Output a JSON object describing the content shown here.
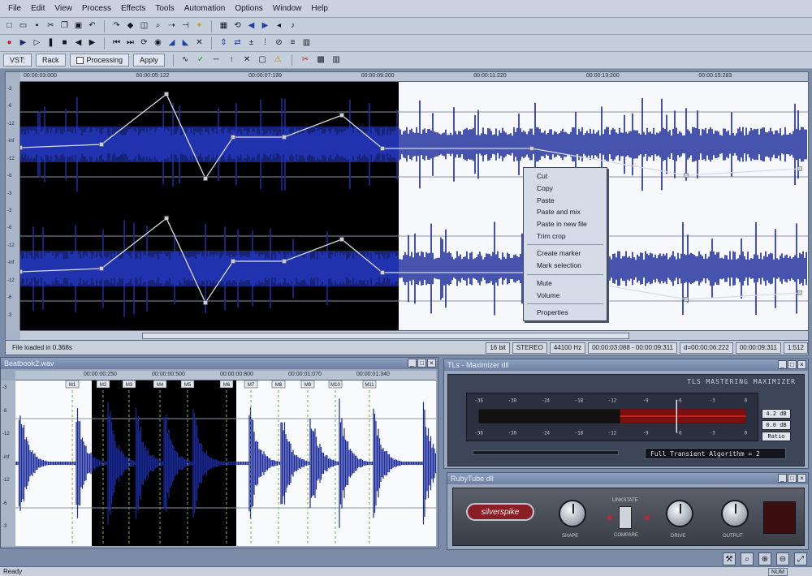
{
  "menu": [
    "File",
    "Edit",
    "View",
    "Process",
    "Effects",
    "Tools",
    "Automation",
    "Options",
    "Window",
    "Help"
  ],
  "toolbar1_icons": [
    "new-icon",
    "open-icon",
    "save-icon",
    "cut-icon",
    "copy-icon",
    "paste-icon",
    "undo-icon",
    "redo-icon",
    "marker-icon",
    "region-icon",
    "zoom-icon",
    "select-icon",
    "snap-icon",
    "bulb-icon",
    "grid-icon",
    "loop-icon",
    "arrow-left-icon",
    "arrow-right-icon",
    "arrow-left-small-icon",
    "speaker-icon"
  ],
  "toolbar2_icons": [
    "record-icon",
    "play-icon",
    "play-all-icon",
    "pause-icon",
    "stop-icon",
    "rewind-icon",
    "forward-icon",
    "go-start-icon",
    "go-end-icon",
    "loop-play-icon",
    "monitor-icon",
    "fade-in-icon",
    "fade-out-icon",
    "crossfade-icon",
    "normalize-icon",
    "reverse-icon",
    "gain-icon",
    "markers-icon",
    "mute-icon",
    "dc-icon",
    "trash-icon"
  ],
  "toolbar3": {
    "vst_label": "VST:",
    "rack_label": "Rack",
    "processing_label": "Processing",
    "apply_label": "Apply",
    "icons": [
      "envelope-icon",
      "check-icon",
      "dash-icon",
      "arrow-up-icon",
      "cross-icon",
      "box-icon",
      "warning-icon",
      "cut-red-icon",
      "lock-icon",
      "trash-icon"
    ]
  },
  "main": {
    "ruler_ticks": [
      "00:00:03:000",
      "00:00:05:122",
      "00:00:07:199",
      "00:00:09:200",
      "00:00:11:220",
      "00:00:13:200",
      "00:00:15:283"
    ],
    "scale_labels": [
      "-3",
      "-6",
      "-12",
      "-inf",
      "-12",
      "-6",
      "-3",
      "-3",
      "-6",
      "-12",
      "-inf",
      "-12",
      "-6",
      "-3"
    ],
    "status": {
      "message": "File loaded in 0.368s",
      "bits": "16 bit",
      "channels": "STEREO",
      "rate": "44100 Hz",
      "range": "00:00:03:088 - 00:00:09:311",
      "duration": "d=00:00:06:222",
      "position": "00:00:09:311",
      "zoom": "1:512"
    }
  },
  "context_menu": {
    "group1": [
      "Cut",
      "Copy",
      "Paste",
      "Paste and mix",
      "Paste in new file",
      "Trim crop"
    ],
    "group2": [
      "Create marker",
      "Mark selection"
    ],
    "group3": [
      "Mute",
      "Volume"
    ],
    "group4": [
      "Properties"
    ]
  },
  "win2": {
    "title": "Beatbook2.wav",
    "ruler_ticks": [
      "00:00:00:250",
      "00:00:00:500",
      "00:00:00:800",
      "00:00:01:070",
      "00:00:01:340"
    ],
    "markers": [
      "M1",
      "M2",
      "M3",
      "M4",
      "M5",
      "M6",
      "M7",
      "M8",
      "M9",
      "M10",
      "M11"
    ],
    "scale_labels": [
      "-3",
      "-6",
      "-12",
      "-inf",
      "-12",
      "-6",
      "-3"
    ]
  },
  "win3": {
    "title": "TLs - Maximizer dll",
    "plugin_title": "TLS MASTERING MAXIMIZER",
    "meter_scale": [
      "-36",
      "-30",
      "-24",
      "-18",
      "-12",
      "-9",
      "-6",
      "-3",
      "0"
    ],
    "readout": [
      "4.2 dB",
      "0.0 dB",
      "Ratio"
    ],
    "algorithm": "Full Transient Algorithm = 2"
  },
  "win4": {
    "title": "RubyTube dll",
    "logo": "silverspike",
    "knobs": [
      "SHAPE",
      "DRIVE",
      "OUTPUT"
    ],
    "switch_top": "LINKSTATE",
    "switch_bottom": "COMPARE"
  },
  "bottom_icons": [
    "wrench-icon",
    "magnify-icon",
    "zoom-in-icon",
    "zoom-out-icon",
    "fit-icon"
  ],
  "statusbar": {
    "left": "Ready",
    "num": "NUM"
  }
}
